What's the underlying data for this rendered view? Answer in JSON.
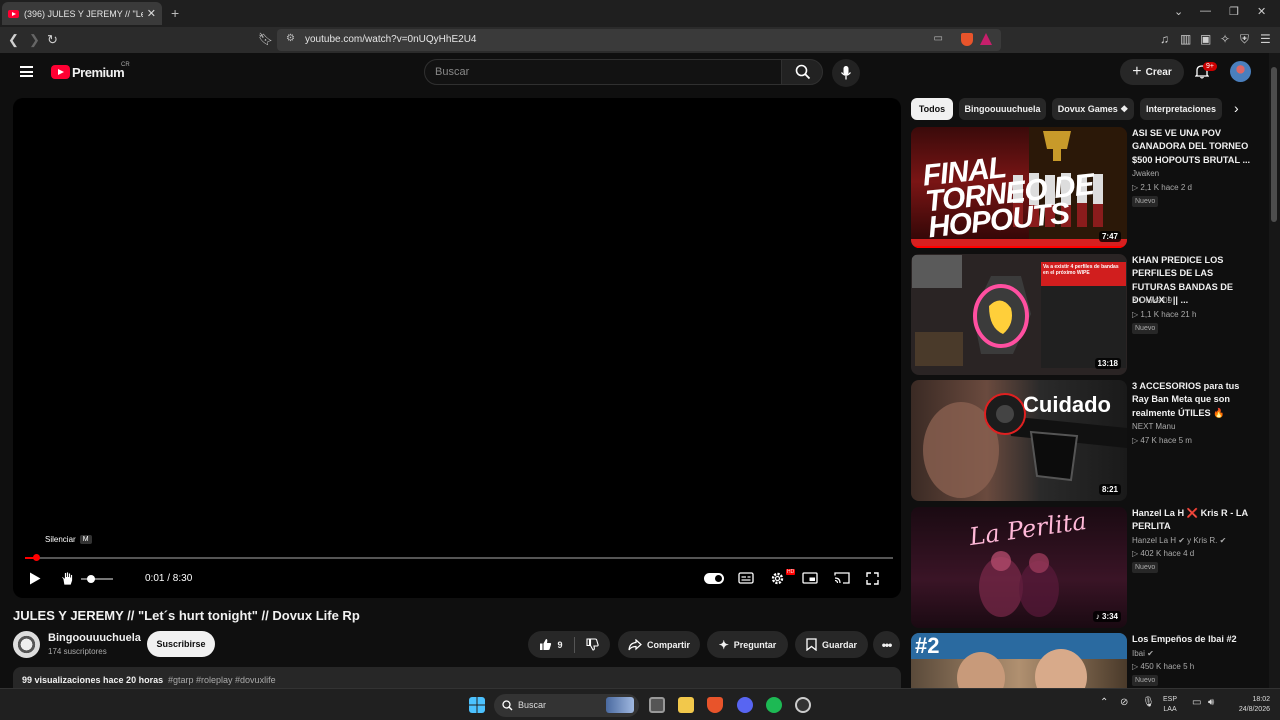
{
  "browser": {
    "tab_title": "(396) JULES Y JEREMY // \"Let´s hu",
    "tab_close": "✕",
    "new_tab": "+",
    "url": "youtube.com/watch?v=0nUQyHhE2U4"
  },
  "youtube": {
    "logo_text": "Premium",
    "logo_region": "CR",
    "search_placeholder": "Buscar",
    "create_label": "Crear",
    "notifications_badge": "9+"
  },
  "player": {
    "tooltip_label": "Silenciar",
    "tooltip_key": "M",
    "time": "0:01 / 8:30",
    "progress_fraction": 0.002,
    "hd_badge": "HD"
  },
  "video": {
    "title": "JULES Y JEREMY // \"Let´s hurt tonight\" // Dovux Life Rp",
    "channel": "Bingoouuuchuela",
    "subscribers": "174 suscriptores",
    "subscribe_label": "Suscribirse",
    "likes": "9",
    "share_label": "Compartir",
    "ask_label": "Preguntar",
    "save_label": "Guardar",
    "views_date": "99 visualizaciones  hace 20 horas",
    "tags": "#gtarp #roleplay #dovuxlife"
  },
  "chips": [
    "Todos",
    "Bingoouuuchuela",
    "Dovux Games ❖",
    "Interpretaciones"
  ],
  "recommendations": [
    {
      "title": "ASI SE VE UNA POV GANADORA DEL TORNEO $500 HOPOUTS BRUTAL ...",
      "channel": "Jwaken",
      "meta": "▷ 2,1 K  hace 2 d",
      "badge": "Nuevo",
      "duration": "7:47",
      "thumb_text": "FINAL TORNEO DE HOPOUTS"
    },
    {
      "title": "KHAN PREDICE LOS PERFILES DE LAS FUTURAS BANDAS DE DOVUX ! || ...",
      "channel": "X Drake 09",
      "meta": "▷ 1,1 K  hace 21 h",
      "badge": "Nuevo",
      "duration": "13:18",
      "thumb_text": "Va a existir 4 perfiles de bandas en el próximo WIPE"
    },
    {
      "title": "3 ACCESORIOS para tus Ray Ban Meta que son realmente ÚTILES 🔥",
      "channel": "NEXT Manu",
      "meta": "▷ 47 K  hace 5 m",
      "badge": "",
      "duration": "8:21",
      "thumb_text": "Cuidado"
    },
    {
      "title": "Hanzel La H ❌ Kris R - LA PERLITA",
      "channel": "Hanzel La H ✔ y Kris R. ✔",
      "meta": "▷ 402 K  hace 4 d",
      "badge": "Nuevo",
      "duration": "♪ 3:34",
      "thumb_text": "La Perlita"
    },
    {
      "title": "Los Empeños de Ibai #2",
      "channel": "Ibai ✔",
      "meta": "▷ 450 K  hace 5 h",
      "badge": "Nuevo",
      "duration": "",
      "thumb_text": "#2"
    }
  ],
  "taskbar": {
    "search_label": "Buscar",
    "lang_top": "ESP",
    "lang_bottom": "LAA",
    "time": "18:02",
    "date": "24/8/2026"
  }
}
